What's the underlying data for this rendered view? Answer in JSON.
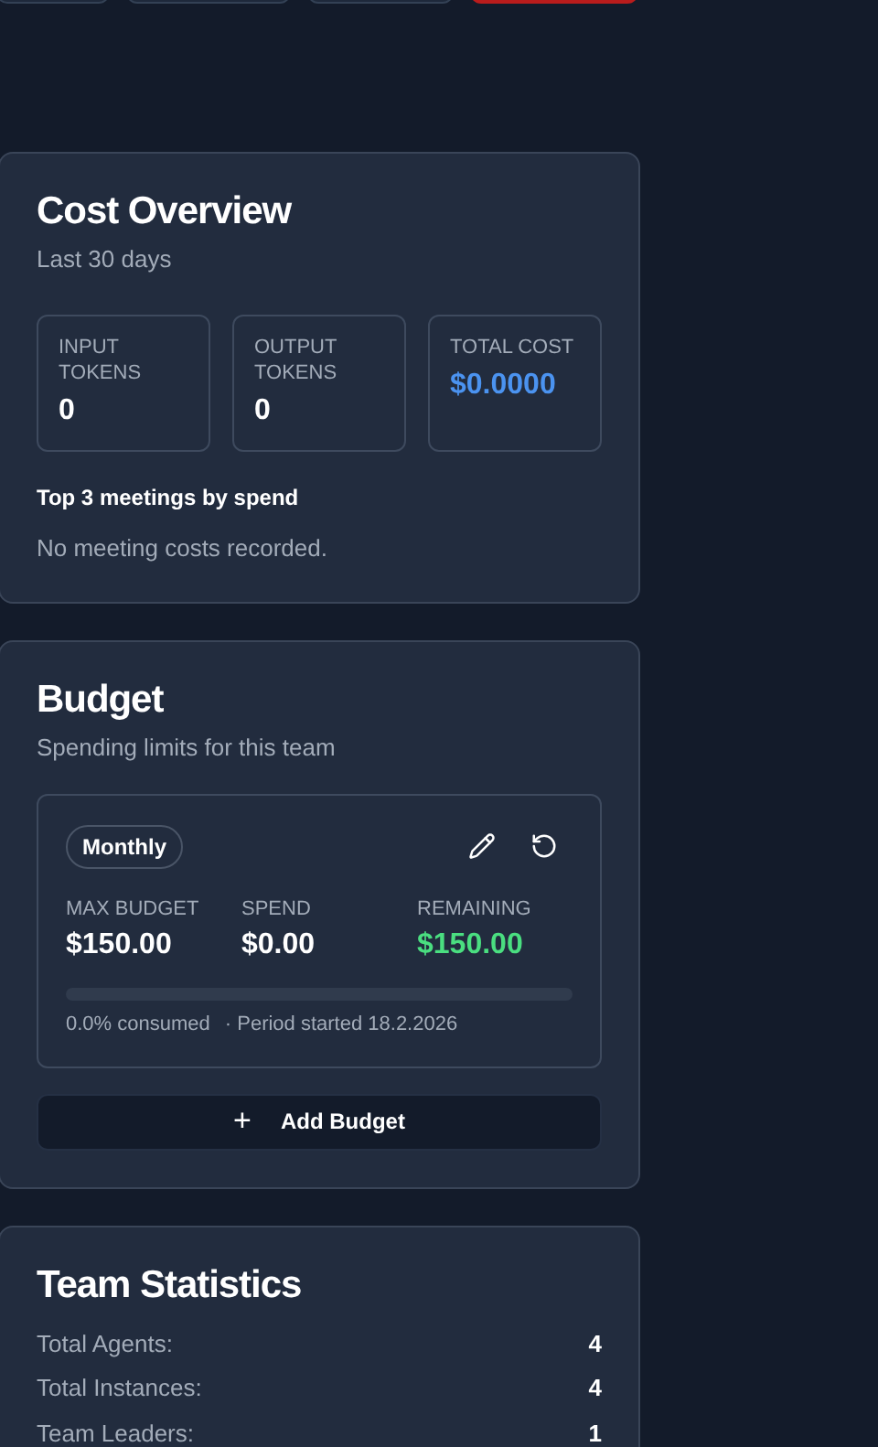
{
  "top_buttons": [
    {
      "kind": "outline"
    },
    {
      "kind": "outline"
    },
    {
      "kind": "outline"
    },
    {
      "kind": "danger"
    }
  ],
  "cost_overview": {
    "title": "Cost Overview",
    "subtitle": "Last 30 days",
    "stats": [
      {
        "label": "INPUT TOKENS",
        "value": "0",
        "kind": "plain"
      },
      {
        "label": "OUTPUT TOKENS",
        "value": "0",
        "kind": "plain"
      },
      {
        "label": "TOTAL COST",
        "value": "$0.0000",
        "kind": "accent"
      }
    ],
    "top_heading": "Top 3 meetings by spend",
    "empty_text": "No meeting costs recorded."
  },
  "budget": {
    "title": "Budget",
    "subtitle": "Spending limits for this team",
    "entry": {
      "period": "Monthly",
      "figures": [
        {
          "label": "MAX BUDGET",
          "value": "$150.00",
          "kind": "plain"
        },
        {
          "label": "SPEND",
          "value": "$0.00",
          "kind": "plain"
        },
        {
          "label": "REMAINING",
          "value": "$150.00",
          "kind": "positive"
        }
      ],
      "level": 0,
      "consumed": "0.0% consumed",
      "period_started": "· Period started 18.2.2026"
    },
    "add_button": {
      "icon": "+",
      "label": "Add Budget"
    }
  },
  "team_statistics": {
    "title": "Team Statistics",
    "rows": [
      {
        "label": "Total Agents:",
        "value": "4"
      },
      {
        "label": "Total Instances:",
        "value": "4"
      },
      {
        "label": "Team Leaders:",
        "value": "1"
      }
    ]
  }
}
